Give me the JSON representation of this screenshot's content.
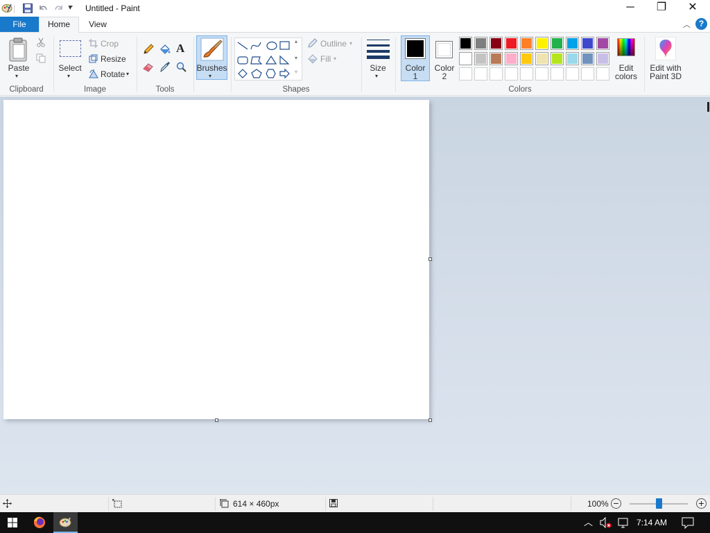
{
  "window": {
    "title": "Untitled - Paint",
    "minimize": "─",
    "restore": "❐",
    "close": "✕"
  },
  "tabs": {
    "file": "File",
    "home": "Home",
    "view": "View"
  },
  "ribbon": {
    "clipboard": {
      "paste": "Paste",
      "group": "Clipboard"
    },
    "image": {
      "select": "Select",
      "crop": "Crop",
      "resize": "Resize",
      "rotate": "Rotate",
      "group": "Image"
    },
    "tools": {
      "group": "Tools"
    },
    "brushes": {
      "label": "Brushes"
    },
    "shapes": {
      "outline": "Outline",
      "fill": "Fill",
      "group": "Shapes"
    },
    "size": {
      "label": "Size"
    },
    "colors": {
      "color1_line1": "Color",
      "color1_line2": "1",
      "color2_line1": "Color",
      "color2_line2": "2",
      "edit_line1": "Edit",
      "edit_line2": "colors",
      "group": "Colors",
      "color1_value": "#000000",
      "color2_value": "#ffffff",
      "palette_row1": [
        "#000000",
        "#7f7f7f",
        "#880015",
        "#ed1c24",
        "#ff7f27",
        "#fff200",
        "#22b14c",
        "#00a2e8",
        "#3f48cc",
        "#a349a4"
      ],
      "palette_row2": [
        "#ffffff",
        "#c3c3c3",
        "#b97a57",
        "#ffaec9",
        "#ffc90e",
        "#efe4b0",
        "#b5e61d",
        "#99d9ea",
        "#7092be",
        "#c8bfe7"
      ]
    },
    "paint3d": {
      "line1": "Edit with",
      "line2": "Paint 3D"
    }
  },
  "statusbar": {
    "canvas_size": "614 × 460px",
    "zoom": "100%"
  },
  "taskbar": {
    "time": "7:14 AM"
  }
}
